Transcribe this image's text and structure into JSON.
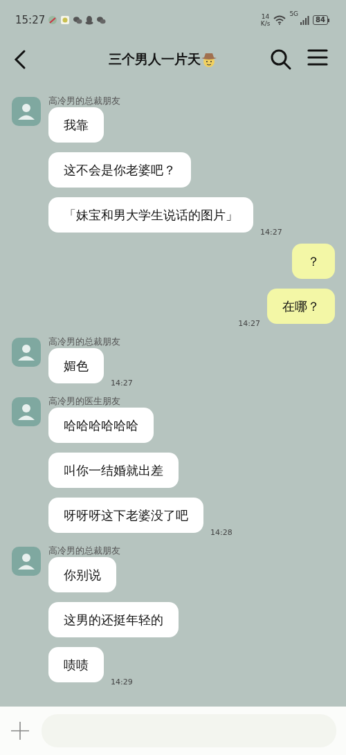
{
  "status_bar": {
    "time": "15:27",
    "speed": "14",
    "speed_unit": "K/s",
    "network": "5G",
    "battery": "84"
  },
  "header": {
    "title": "三个男人一片天"
  },
  "messages": [
    {
      "kind": "incoming",
      "sender": "高冷男的总裁朋友",
      "bubbles": [
        "我靠",
        "这不会是你老婆吧？",
        "「妹宝和男大学生说话的图片」"
      ],
      "time": "14:27"
    },
    {
      "kind": "outgoing",
      "bubbles": [
        "？",
        "在哪？"
      ],
      "time": "14:27"
    },
    {
      "kind": "incoming",
      "sender": "高冷男的总裁朋友",
      "bubbles": [
        "媚色"
      ],
      "time": "14:27"
    },
    {
      "kind": "incoming",
      "sender": "高冷男的医生朋友",
      "bubbles": [
        "哈哈哈哈哈哈",
        "叫你一结婚就出差",
        "呀呀呀这下老婆没了吧"
      ],
      "time": "14:28"
    },
    {
      "kind": "incoming",
      "sender": "高冷男的总裁朋友",
      "bubbles": [
        "你别说",
        "这男的还挺年轻的",
        "啧啧"
      ],
      "time": "14:29"
    }
  ]
}
